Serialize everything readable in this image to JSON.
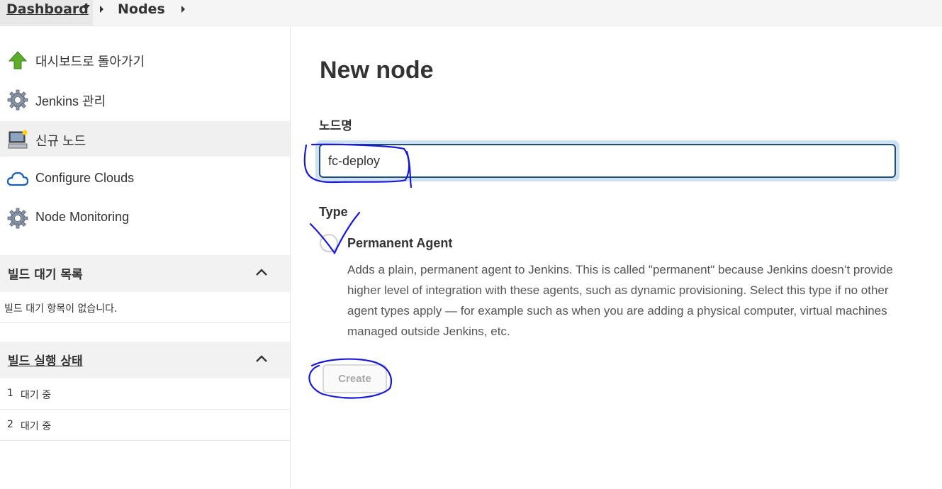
{
  "breadcrumb": {
    "dashboard": "Dashboard",
    "nodes": "Nodes"
  },
  "sidebar": {
    "items": [
      {
        "label": "대시보드로 돌아가기",
        "icon": "up-arrow-icon"
      },
      {
        "label": "Jenkins 관리",
        "icon": "gear-icon"
      },
      {
        "label": "신규 노드",
        "icon": "computer-icon"
      },
      {
        "label": "Configure Clouds",
        "icon": "cloud-icon"
      },
      {
        "label": "Node Monitoring",
        "icon": "gear-icon"
      }
    ],
    "build_queue": {
      "title": "빌드 대기 목록",
      "empty_text": "빌드 대기 항목이 없습니다."
    },
    "executor_status": {
      "title": "빌드 실행 상태",
      "rows": [
        {
          "num": "1",
          "status": "대기 중"
        },
        {
          "num": "2",
          "status": "대기 중"
        }
      ]
    }
  },
  "main": {
    "title": "New node",
    "name_label": "노드명",
    "name_value": "fc-deploy",
    "type_label": "Type",
    "option_label": "Permanent Agent",
    "option_description": "Adds a plain, permanent agent to Jenkins. This is called \"permanent\" because Jenkins doesn’t provide higher level of integration with these agents, such as dynamic provisioning. Select this type if no other agent types apply — for example such as when you are adding a physical computer, virtual machines managed outside Jenkins, etc.",
    "create_label": "Create"
  },
  "colors": {
    "input_border": "#1f4e79",
    "input_halo": "#cfe0f0",
    "annotation_ink": "#1a1ad6",
    "active_item_bg": "#f0f0f0"
  }
}
